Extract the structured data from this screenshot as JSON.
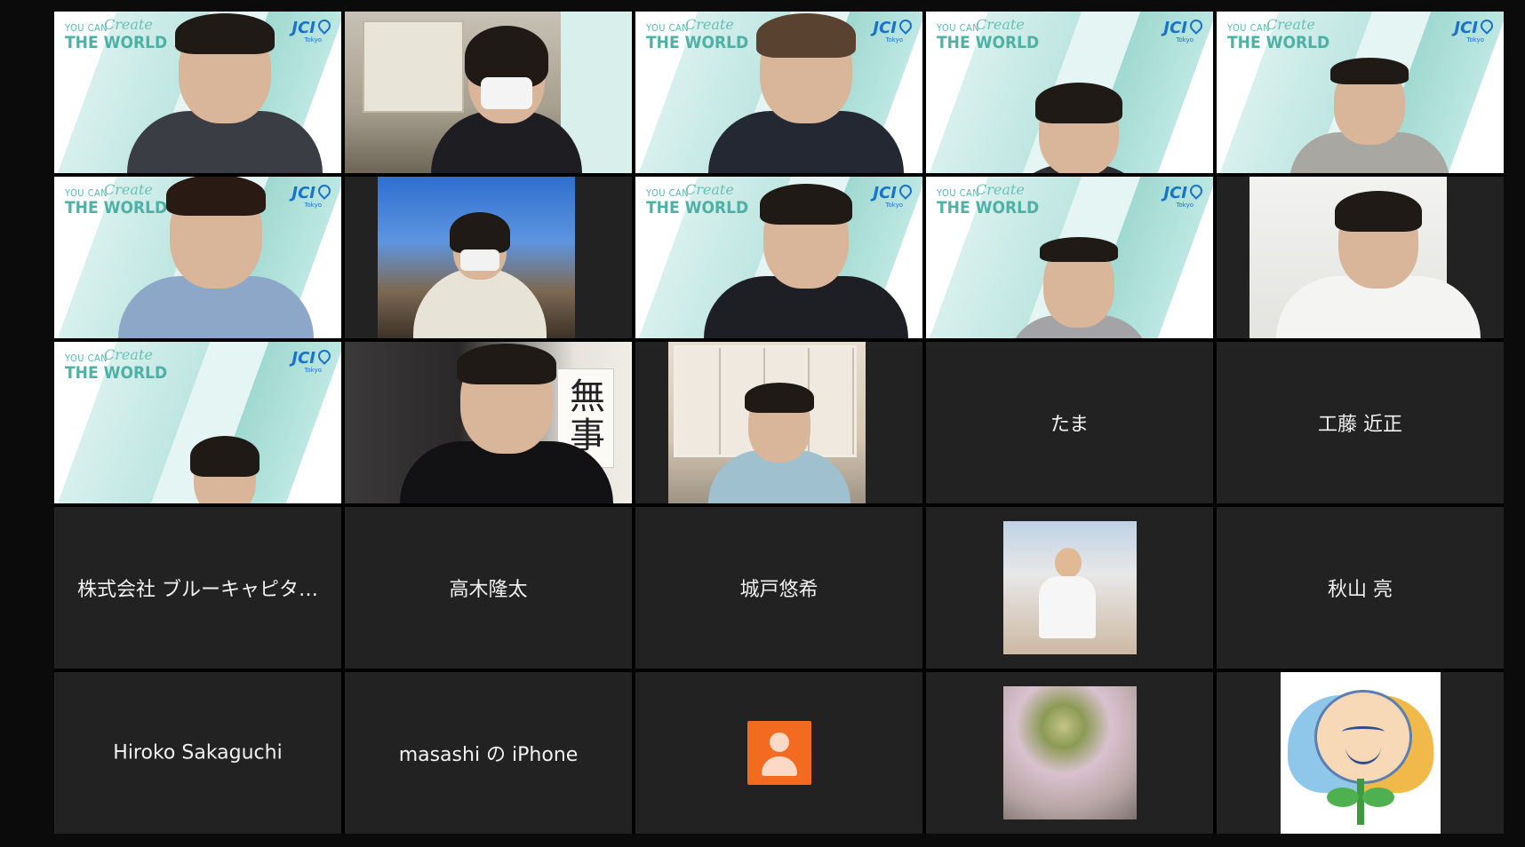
{
  "meeting": {
    "participants": [
      {
        "id": "p1",
        "kind": "video",
        "background": "JCI virtual background"
      },
      {
        "id": "p2",
        "kind": "video",
        "background": "JCI virtual background"
      },
      {
        "id": "p3",
        "kind": "video",
        "background": "JCI virtual background"
      },
      {
        "id": "p4",
        "kind": "video",
        "background": "JCI virtual background"
      },
      {
        "id": "p5",
        "kind": "video",
        "background": "JCI virtual background"
      },
      {
        "id": "p6",
        "kind": "video",
        "background": "JCI virtual background"
      },
      {
        "id": "p7",
        "kind": "video",
        "background": "outdoor"
      },
      {
        "id": "p8",
        "kind": "video",
        "background": "JCI virtual background",
        "active_speaker": true
      },
      {
        "id": "p9",
        "kind": "video",
        "background": "JCI virtual background"
      },
      {
        "id": "p10",
        "kind": "video",
        "background": "wall"
      },
      {
        "id": "p11",
        "kind": "video",
        "background": "JCI virtual background"
      },
      {
        "id": "p12",
        "kind": "video",
        "background": "office"
      },
      {
        "id": "p13",
        "kind": "video",
        "background": "bookshelf room"
      },
      {
        "id": "p14",
        "kind": "name",
        "name": "たま"
      },
      {
        "id": "p15",
        "kind": "name",
        "name": "工藤 近正"
      },
      {
        "id": "p16",
        "kind": "name",
        "name": "株式会社 ブルーキャピタ…"
      },
      {
        "id": "p17",
        "kind": "name",
        "name": "高木隆太"
      },
      {
        "id": "p18",
        "kind": "name",
        "name": "城戸悠希"
      },
      {
        "id": "p19",
        "kind": "photo",
        "icon": "profile-photo"
      },
      {
        "id": "p20",
        "kind": "name",
        "name": "秋山 亮"
      },
      {
        "id": "p21",
        "kind": "name",
        "name": "Hiroko Sakaguchi"
      },
      {
        "id": "p22",
        "kind": "name",
        "name": "masashi の iPhone"
      },
      {
        "id": "p23",
        "kind": "avatar",
        "icon": "default-user-avatar"
      },
      {
        "id": "p24",
        "kind": "photo",
        "icon": "flower-photo"
      },
      {
        "id": "p25",
        "kind": "photo",
        "icon": "mascot-logo"
      }
    ]
  },
  "virtual_background": {
    "youcan": "YOU CAN",
    "create": "Create",
    "world": "THE WORLD",
    "org": "JCI",
    "city": "Tokyo",
    "accent_color": "#4fb1a6",
    "brand_color": "#1a73c8"
  },
  "darkroom": {
    "scroll_text": "無事"
  },
  "colors": {
    "background": "#0b0b0b",
    "tile": "#222222",
    "active_speaker_border": "#e4e05a",
    "avatar_orange": "#f26b21"
  }
}
